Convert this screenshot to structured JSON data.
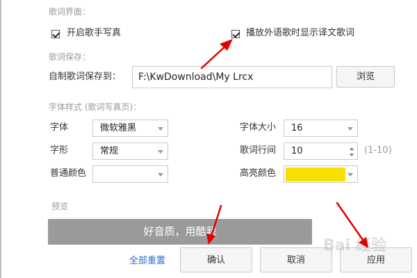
{
  "sections": {
    "lyrics_ui": "歌词界面：",
    "lyrics_save": "歌词保存：",
    "font_style": "字体样式 (歌词写真页)：",
    "preview": "预览"
  },
  "options": {
    "artist_photo": {
      "label": "开启歌手写真",
      "checked": true
    },
    "show_translation": {
      "label": "播放外语歌时显示译文歌词",
      "checked": true
    }
  },
  "save": {
    "label": "自制歌词保存到：",
    "path": "F:\\KwDownload\\My Lrcx",
    "browse_label": "浏览"
  },
  "font": {
    "font_label": "字体",
    "font_value": "微软雅黑",
    "style_label": "字形",
    "style_value": "常规",
    "normal_color_label": "普通颜色",
    "normal_color": "#ffffff",
    "size_label": "字体大小",
    "size_value": "16",
    "line_spacing_label": "歌词行间",
    "line_spacing_value": "10",
    "line_spacing_range": "(1-10)",
    "highlight_color_label": "高亮颜色",
    "highlight_color": "#f5e000"
  },
  "preview": {
    "text": "好音质，用酷我",
    "bg": "#9a9a9a"
  },
  "buttons": {
    "reset": "全部重置",
    "confirm": "确认",
    "cancel": "取消",
    "apply": "应用"
  },
  "colors": {
    "arrow": "#e00000",
    "link": "#2a6bd0"
  },
  "watermark": "Bai 经验"
}
